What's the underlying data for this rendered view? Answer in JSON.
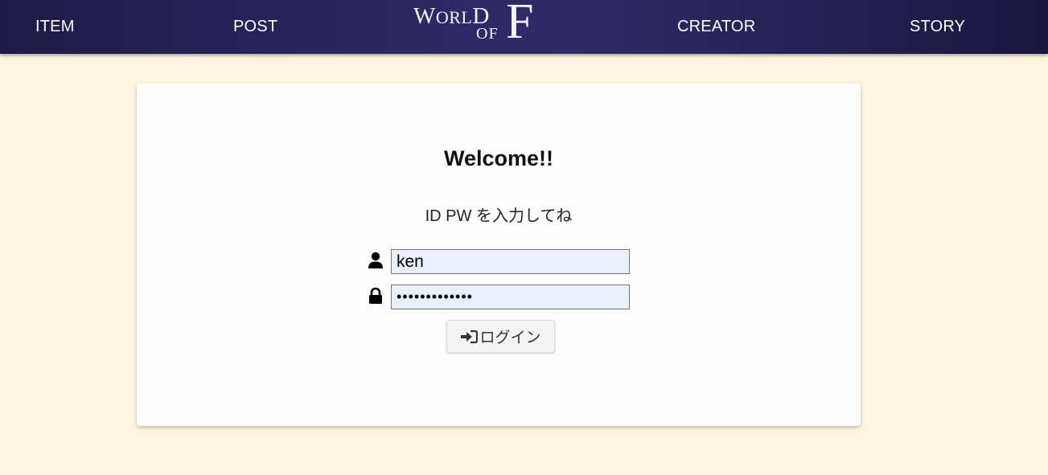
{
  "nav": {
    "items": [
      {
        "label": "ITEM"
      },
      {
        "label": "POST"
      },
      {
        "label": "CREATOR"
      },
      {
        "label": "STORY"
      }
    ],
    "logo": {
      "line1_big_w": "W",
      "line1_small": "ORL",
      "line1_big_d": "D",
      "line2": "OF",
      "big_letter": "F"
    }
  },
  "login": {
    "title": "Welcome!!",
    "instruction": "ID PW を入力してね",
    "username": {
      "icon": "user-icon",
      "value": "ken"
    },
    "password": {
      "icon": "lock-icon",
      "value": "•••••••••••••"
    },
    "submit": {
      "icon": "sign-in-icon",
      "label": "ログイン"
    }
  },
  "colors": {
    "nav_background": "#2f2a66",
    "page_background": "#fff4e2",
    "card_background": "#fdfdfd",
    "field_background": "#e8f0fe"
  }
}
